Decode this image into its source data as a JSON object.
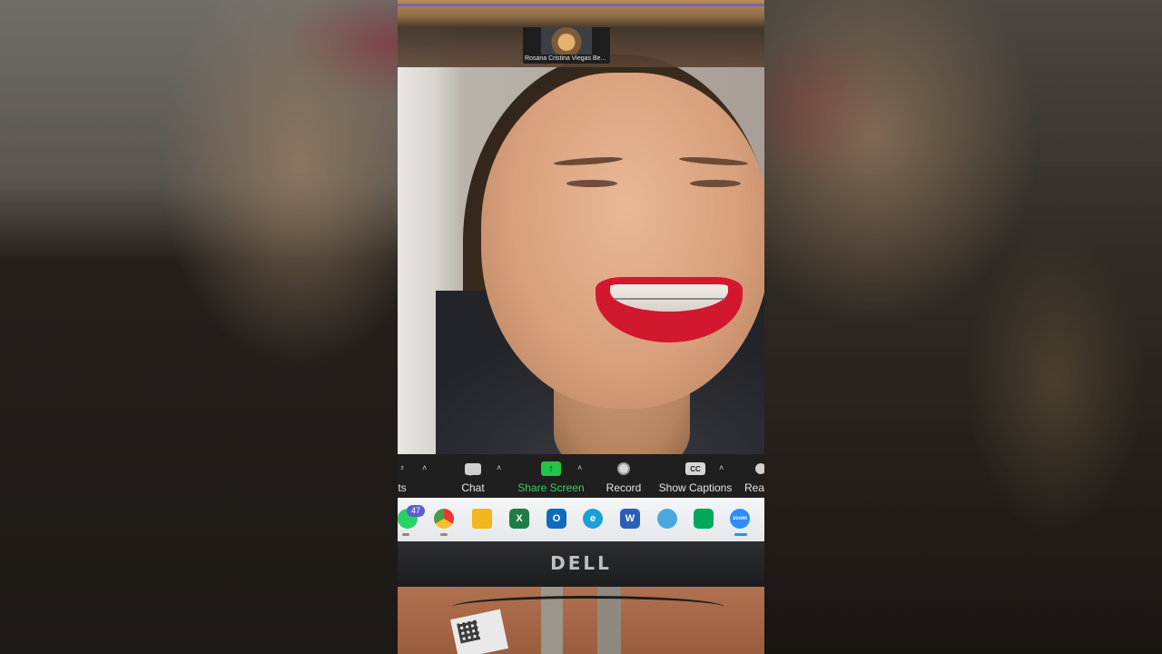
{
  "zoom": {
    "thumbnail": {
      "participant_name": "Rosana Cristina Viegas Be..."
    },
    "toolbar": {
      "items": [
        {
          "label": "ts",
          "icon": "participants-icon"
        },
        {
          "label": "Chat",
          "icon": "chat-icon"
        },
        {
          "label": "Share Screen",
          "icon": "share-screen-icon",
          "icon_glyph": "↑"
        },
        {
          "label": "Record",
          "icon": "record-icon"
        },
        {
          "label": "Show Captions",
          "icon": "captions-icon",
          "icon_text": "CC"
        },
        {
          "label": "Reac",
          "icon": "reactions-icon"
        }
      ],
      "caret": "˄",
      "share_color": "#22c44a"
    }
  },
  "taskbar": {
    "apps": [
      {
        "name": "whatsapp-icon",
        "badge": "47",
        "color": "#25d366"
      },
      {
        "name": "chrome-icon",
        "color": "#e53935"
      },
      {
        "name": "file-explorer-icon",
        "color": "#f2b71c"
      },
      {
        "name": "excel-icon",
        "glyph": "X",
        "color": "#1e7b45"
      },
      {
        "name": "outlook-icon",
        "glyph": "O",
        "color": "#0f6cbd"
      },
      {
        "name": "edge-icon",
        "glyph": "e",
        "color": "#1aa0d8"
      },
      {
        "name": "word-icon",
        "glyph": "W",
        "color": "#2b5eb7"
      },
      {
        "name": "photos-icon",
        "color": "#4aa8e0"
      },
      {
        "name": "google-meet-icon",
        "color": "#00a85a"
      },
      {
        "name": "zoom-icon",
        "glyph": "zoom",
        "color": "#2d8cff"
      }
    ]
  },
  "monitor": {
    "brand": "DELL"
  }
}
